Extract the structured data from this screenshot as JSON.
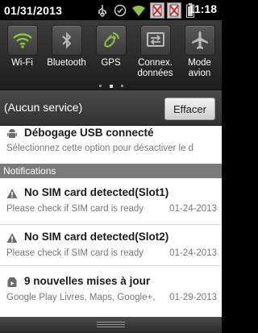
{
  "status_bar": {
    "date": "01/31/2013",
    "time": "11:18",
    "icons": [
      "usb-icon",
      "checkmark-circle-icon",
      "wifi-signal-icon",
      "no-sim-slot1-icon",
      "no-sim-slot2-icon"
    ]
  },
  "toggles": [
    {
      "label": "Wi-Fi",
      "icon": "wifi-icon",
      "active": true
    },
    {
      "label": "Bluetooth",
      "icon": "bluetooth-icon",
      "active": false
    },
    {
      "label": "GPS",
      "icon": "gps-icon",
      "active": true
    },
    {
      "label": "Connex.\ndonnées",
      "label_line1": "Connex.",
      "label_line2": "données",
      "icon": "data-connection-icon",
      "active": false
    },
    {
      "label": "Mode\navion",
      "label_line1": "Mode",
      "label_line2": "avion",
      "icon": "airplane-icon",
      "active": false
    }
  ],
  "pager": {
    "count": 3,
    "active_index": 1
  },
  "service": {
    "text": "(Aucun service)",
    "clear_label": "Effacer"
  },
  "ongoing": {
    "title": "Débogage USB connecté",
    "text": "Sélectionnez cette option pour désactiver le d",
    "icon": "android-debug-icon"
  },
  "notifications_header": "Notifications",
  "notifications": [
    {
      "title": "No SIM card detected(Slot1)",
      "text": "Please check if SIM card is ready",
      "date": "01-24-2013",
      "icon": "warning-icon"
    },
    {
      "title": "No SIM card detected(Slot2)",
      "text": "Please check if SIM card is ready",
      "date": "01-24-2013",
      "icon": "warning-icon"
    },
    {
      "title": "9 nouvelles mises à jour",
      "text": "Google Play Livres, Maps, Google+,",
      "date": "01-29-2013",
      "icon": "play-store-icon"
    }
  ],
  "colors": {
    "accent_green": "#8bc53f",
    "panel_bg": "#ffffff",
    "section_header": "#7a7a7a"
  }
}
